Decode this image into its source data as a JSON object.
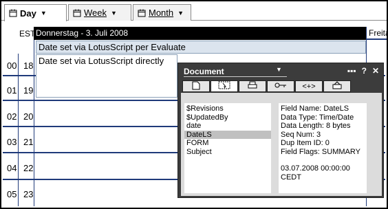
{
  "tabs": [
    {
      "label": "Day",
      "active": true
    },
    {
      "label": "Week",
      "active": false
    },
    {
      "label": "Month",
      "active": false
    }
  ],
  "timezone_label": "EST",
  "hours": [
    {
      "a": "00",
      "b": "18"
    },
    {
      "a": "01",
      "b": "19"
    },
    {
      "a": "02",
      "b": "20"
    },
    {
      "a": "03",
      "b": "21"
    },
    {
      "a": "04",
      "b": "22"
    },
    {
      "a": "05",
      "b": "23"
    }
  ],
  "day_header": "Donnerstag - 3. Juli 2008",
  "next_day_header": "Freitag",
  "entries": {
    "evaluate": "Date set via LotusScript per Evaluate",
    "direct": "Date set via LotusScript directly"
  },
  "panel": {
    "title": "Document",
    "fields": [
      "$Revisions",
      "$UpdatedBy",
      "date",
      "DateLS",
      "FORM",
      "Subject"
    ],
    "selected_field": "DateLS",
    "info": {
      "field_name": "Field Name: DateLS",
      "data_type": "Data Type: Time/Date",
      "data_length": "Data Length: 8 bytes",
      "seq_num": "Seq Num: 3",
      "dup_item_id": "Dup Item ID: 0",
      "field_flags": "Field Flags: SUMMARY",
      "value_line1": "03.07.2008 00:00:00",
      "value_line2": "CEDT"
    }
  },
  "colors": {
    "grid_line": "#1f3a7a",
    "entry_bg": "#dbe4ee",
    "panel_bg": "#3c3c3c"
  }
}
